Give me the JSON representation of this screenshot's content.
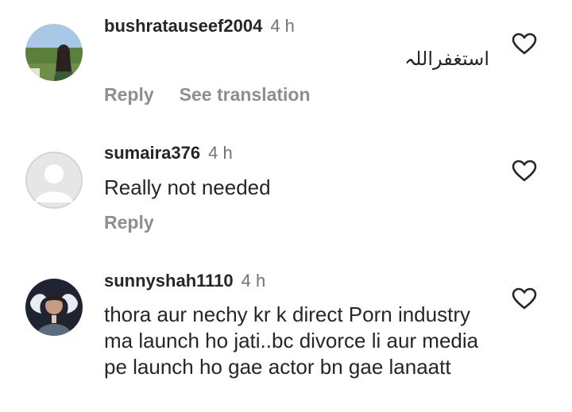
{
  "comments": [
    {
      "username": "bushratauseef2004",
      "time": "4 h",
      "text": "استغفراللہ",
      "actions": {
        "reply": "Reply",
        "translate": "See translation"
      },
      "avatar": "photo-woman-field",
      "like_icon": "heart-outline-icon"
    },
    {
      "username": "sumaira376",
      "time": "4 h",
      "text": "Really not needed",
      "actions": {
        "reply": "Reply"
      },
      "avatar": "default-avatar",
      "like_icon": "heart-outline-icon"
    },
    {
      "username": "sunnyshah1110",
      "time": "4 h",
      "text": "thora aur nechy kr k direct Porn industry ma launch ho jati..bc divorce li aur media pe launch ho gae actor bn gae lanaatt",
      "avatar": "photo-man-wings",
      "like_icon": "heart-outline-icon"
    }
  ],
  "colors": {
    "text": "#262626",
    "muted": "#8e8e8e",
    "time": "#737373"
  }
}
